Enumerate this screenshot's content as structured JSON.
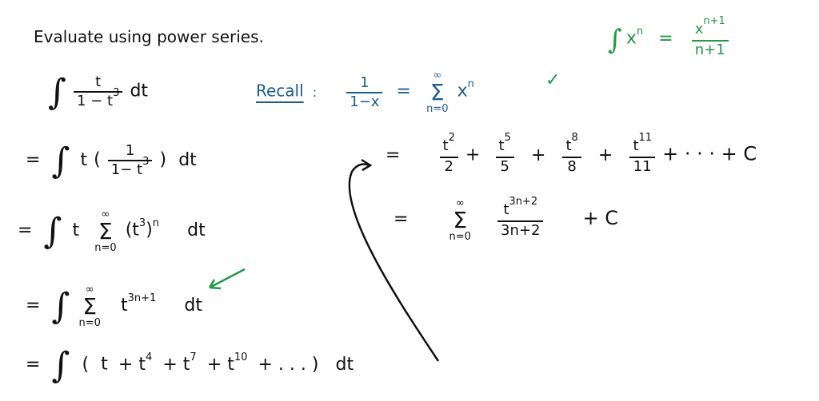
{
  "heading": "Evaluate using power series.",
  "problem": {
    "integrand_num": "t",
    "integrand_den": "1 − t",
    "den_exp": "3",
    "differential": "dt"
  },
  "recall": {
    "label": "Recall",
    "colon": ":",
    "lhs_num": "1",
    "lhs_den": "1−x",
    "eq": "=",
    "sum_top": "∞",
    "sum_bottom": "n=0",
    "term": "x",
    "term_exp": "n",
    "check": "✓"
  },
  "rule": {
    "integral": "∫",
    "base": "x",
    "exp": "n",
    "eq": "=",
    "num": "x",
    "num_exp": "n+1",
    "den": "n+1"
  },
  "steps": [
    {
      "eq": "=",
      "body": "t",
      "frac_num": "1",
      "frac_den": "1− t",
      "den_exp": "3",
      "dt": "dt"
    },
    {
      "eq": "=",
      "body": "t",
      "sum_top": "∞",
      "sum_bottom": "n=0",
      "term": "(t",
      "term_exp_in": "3",
      "term_close": ")",
      "term_exp": "n",
      "dt": "dt"
    },
    {
      "eq": "=",
      "sum_top": "∞",
      "sum_bottom": "n=0",
      "term": "t",
      "term_exp": "3n+1",
      "dt": "dt"
    },
    {
      "eq": "=",
      "open": "(",
      "terms": [
        "t",
        "+ t",
        "+ t",
        "+ t",
        "+ . . . )"
      ],
      "exps": [
        "",
        "4",
        "7",
        "10",
        ""
      ],
      "dt": "dt"
    }
  ],
  "result": {
    "line1": {
      "eq": "=",
      "nums": [
        "t",
        "t",
        "t",
        "t"
      ],
      "exps": [
        "2",
        "5",
        "8",
        "11"
      ],
      "dens": [
        "2",
        "5",
        "8",
        "11"
      ],
      "plus": "+",
      "tail": "+ · · ·  + C"
    },
    "line2": {
      "eq": "=",
      "sum_top": "∞",
      "sum_bottom": "n=0",
      "num": "t",
      "num_exp": "3n+2",
      "den": "3n+2",
      "tail": "+  C"
    }
  },
  "colors": {
    "ink": "#111111",
    "blue": "#1c5c8f",
    "green": "#1f9a45"
  }
}
